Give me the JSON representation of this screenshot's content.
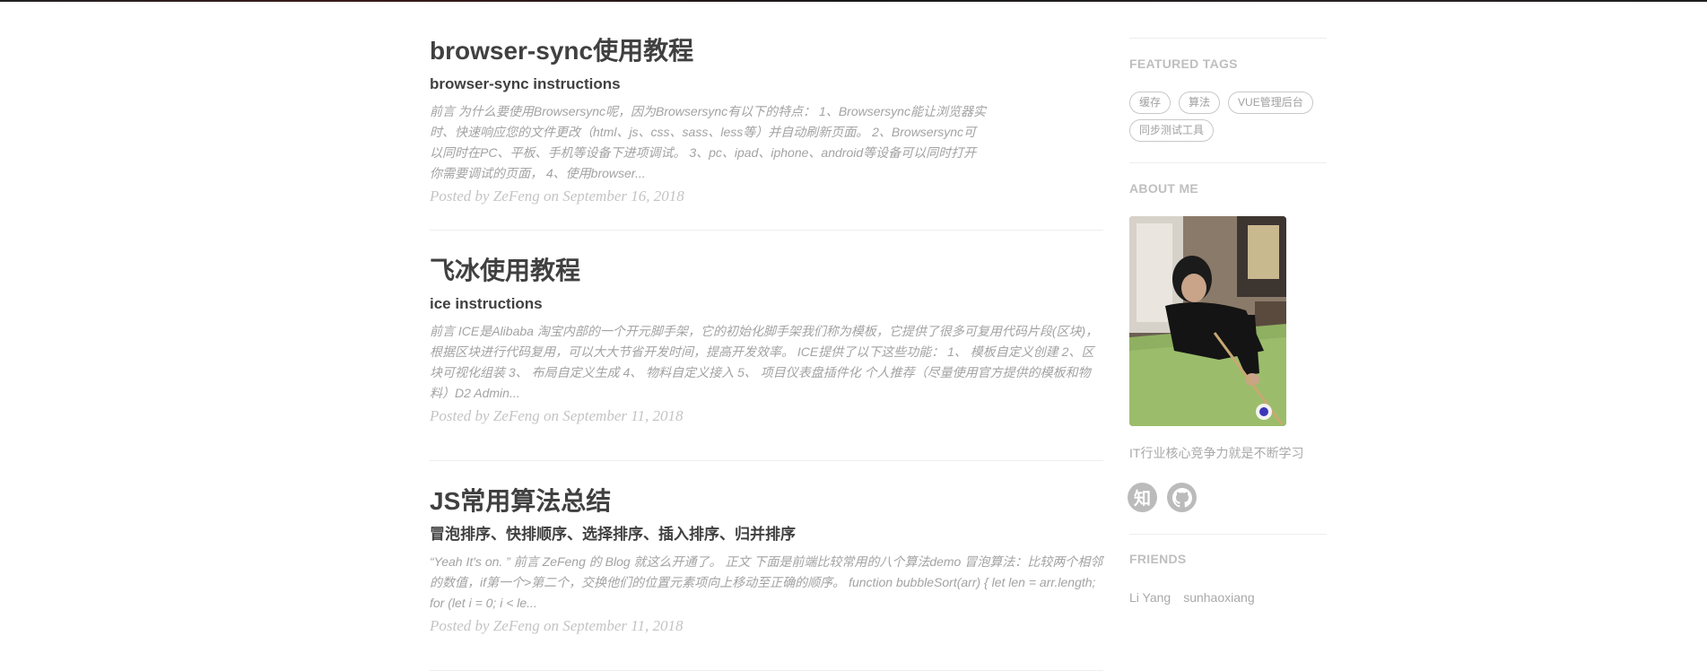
{
  "posts": [
    {
      "title": "browser-sync使用教程",
      "subtitle": "browser-sync instructions",
      "excerpt": "前言 为什么要使用Browsersync呢，因为Browsersync有以下的特点： 1、Browsersync能让浏览器实时、快速响应您的文件更改（html、js、css、sass、less等）并自动刷新页面。 2、Browsersync可以同时在PC、平板、手机等设备下进项调试。 3、pc、ipad、iphone、android等设备可以同时打开你需要调试的页面， 4、使用browser...",
      "meta": "Posted by ZeFeng on September 16, 2018"
    },
    {
      "title": "飞冰使用教程",
      "subtitle": "ice instructions",
      "excerpt": "前言 ICE是Alibaba 淘宝内部的一个开元脚手架，它的初始化脚手架我们称为模板，它提供了很多可复用代码片段(区块)，根据区块进行代码复用，可以大大节省开发时间，提高开发效率。 ICE提供了以下这些功能： 1、 模板自定义创建 2、区块可视化组装 3、 布局自定义生成 4、 物料自定义接入 5、 项目仪表盘插件化 个人推荐（尽量使用官方提供的模板和物料）D2 Admin...",
      "meta": "Posted by ZeFeng on September 11, 2018"
    },
    {
      "title": "JS常用算法总结",
      "subtitle": "冒泡排序、快排顺序、选择排序、插入排序、归并排序",
      "excerpt": "“Yeah It's on. ” 前言 ZeFeng 的 Blog 就这么开通了。 正文 下面是前端比较常用的八个算法demo 冒泡算法：比较两个相邻的数值，if第一个>第二个，交换他们的位置元素项向上移动至正确的顺序。 function bubbleSort(arr) { let len = arr.length; for (let i = 0; i < le...",
      "meta": "Posted by ZeFeng on September 11, 2018"
    }
  ],
  "sidebar": {
    "featured_tags_heading": "FEATURED TAGS",
    "tags": [
      "缓存",
      "算法",
      "VUE管理后台",
      "同步测试工具"
    ],
    "about_heading": "ABOUT ME",
    "about_text": "IT行业核心竞争力就是不断学习",
    "social": {
      "zhihu_label": "知",
      "zhihu_icon": "zhihu-icon",
      "github_icon": "github-icon"
    },
    "friends_heading": "FRIENDS",
    "friends": [
      "Li Yang",
      "sunhaoxiang"
    ]
  }
}
